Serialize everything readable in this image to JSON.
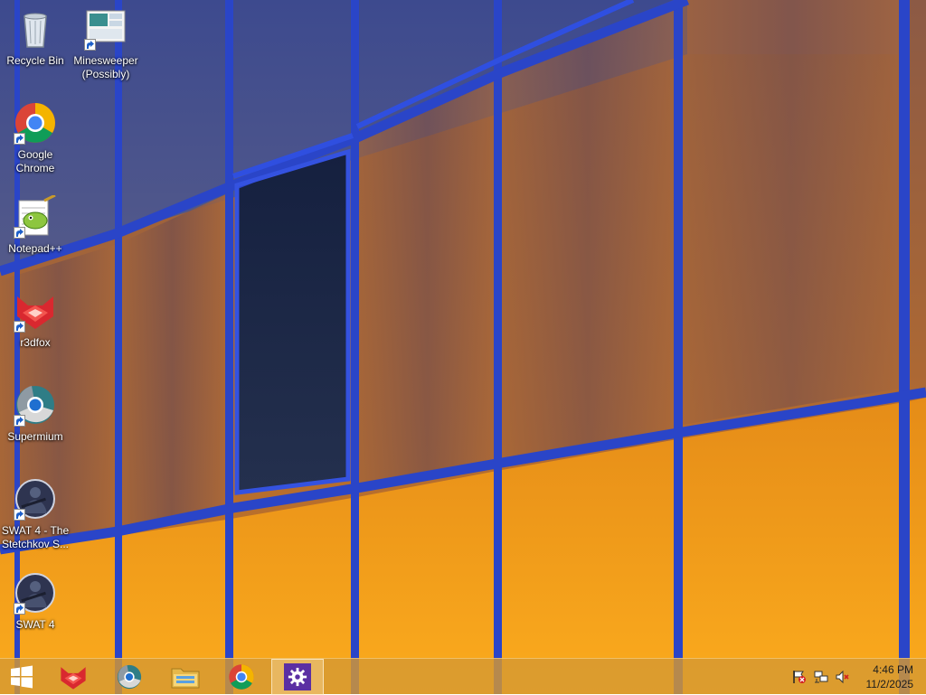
{
  "desktop": {
    "icons": [
      {
        "name": "recycle-bin",
        "label": "Recycle Bin",
        "icon": "recycle-bin-icon",
        "shortcut": false
      },
      {
        "name": "minesweeper",
        "label": "Minesweeper (Possibly)",
        "icon": "minesweeper-icon",
        "shortcut": true
      },
      {
        "name": "google-chrome",
        "label": "Google Chrome",
        "icon": "chrome-icon",
        "shortcut": true
      },
      {
        "name": "notepad-plus-plus",
        "label": "Notepad++",
        "icon": "notepad-plus-plus-icon",
        "shortcut": true
      },
      {
        "name": "r3dfox",
        "label": "r3dfox",
        "icon": "r3dfox-icon",
        "shortcut": true
      },
      {
        "name": "supermium",
        "label": "Supermium",
        "icon": "supermium-icon",
        "shortcut": true
      },
      {
        "name": "swat4-stetchkov",
        "label": "SWAT 4 - The Stetchkov S...",
        "icon": "swat4-icon",
        "shortcut": true
      },
      {
        "name": "swat4",
        "label": "SWAT 4",
        "icon": "swat4-icon",
        "shortcut": true
      }
    ]
  },
  "taskbar": {
    "start_icon": "windows-logo-icon",
    "pinned": [
      {
        "name": "r3dfox",
        "icon": "r3dfox-icon",
        "active": false
      },
      {
        "name": "supermium",
        "icon": "supermium-icon",
        "active": false
      },
      {
        "name": "file-explorer",
        "icon": "folder-icon",
        "active": false
      },
      {
        "name": "google-chrome",
        "icon": "chrome-icon",
        "active": false
      },
      {
        "name": "settings",
        "icon": "gear-icon",
        "active": true
      }
    ],
    "tray": {
      "icons": [
        "action-center-flag-icon",
        "network-icon",
        "volume-muted-icon"
      ],
      "time": "4:46 PM",
      "date": "11/2/2025"
    }
  },
  "colors": {
    "wallpaper_frame": "#2a45c8",
    "wallpaper_glow": "#f7a21b",
    "wallpaper_dim": "#6a4a50",
    "taskbar": "#d69832",
    "settings_tile": "#5b2fa3"
  }
}
